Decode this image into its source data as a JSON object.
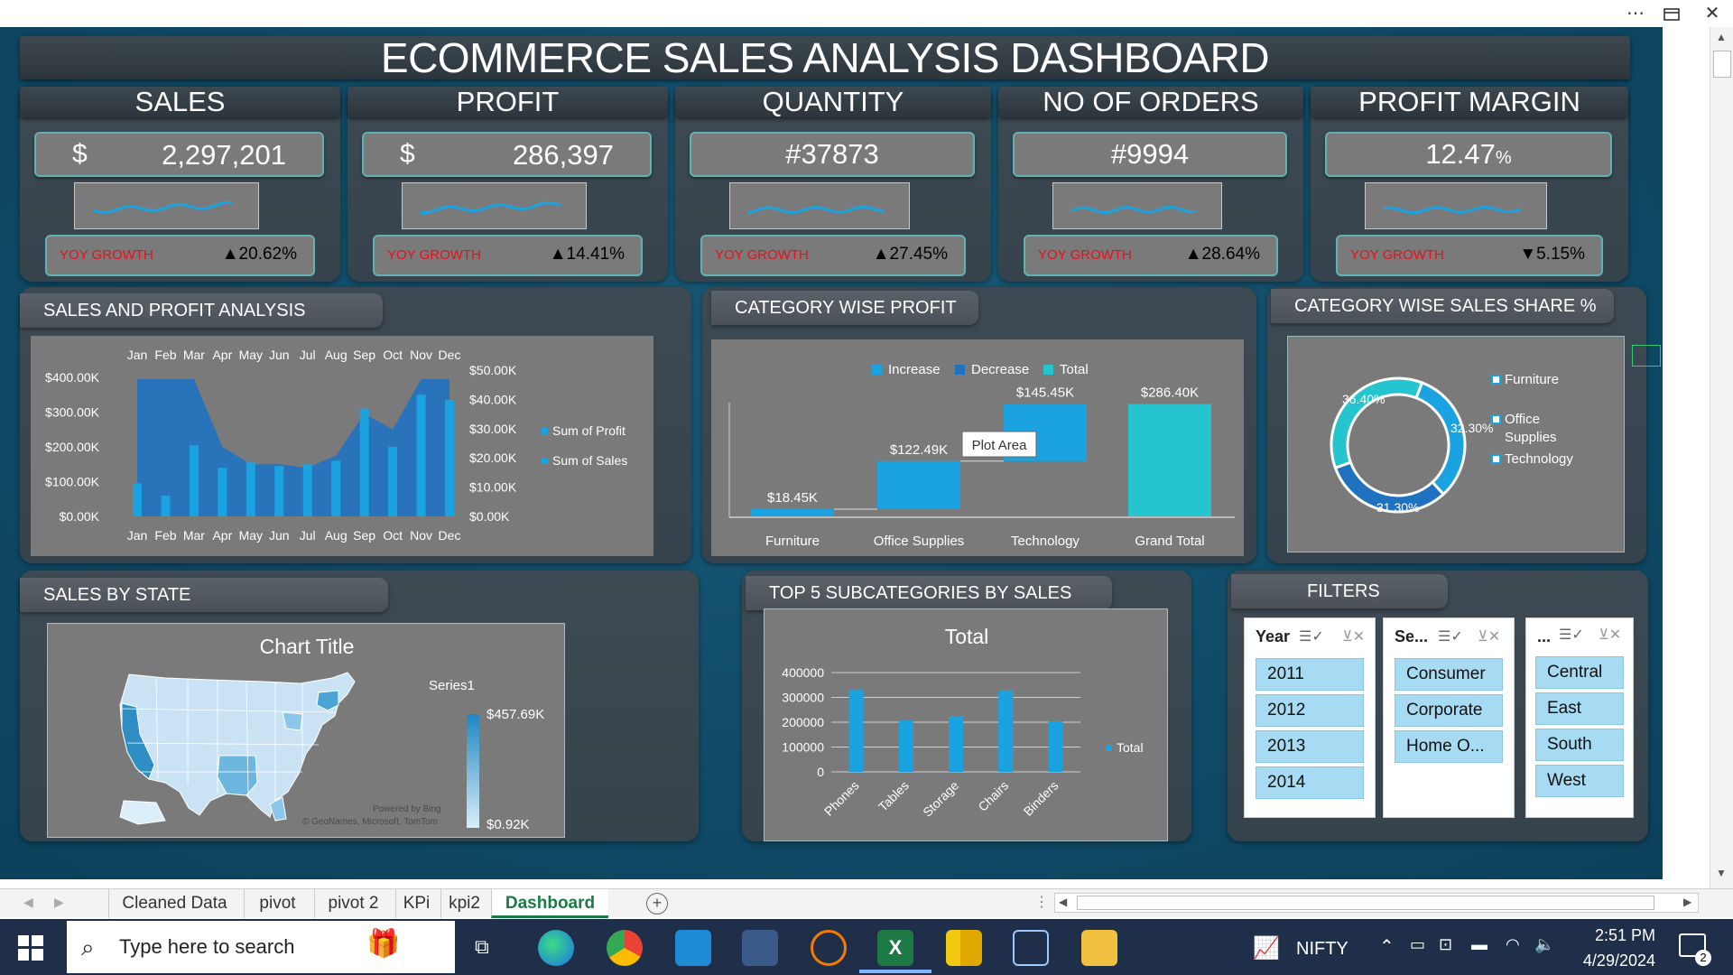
{
  "window": {
    "more_icon": "more-icon",
    "restore_icon": "restore-icon",
    "close_icon": "close-icon"
  },
  "dashboard": {
    "title": "ECOMMERCE SALES ANALYSIS DASHBOARD",
    "kpis": [
      {
        "label": "SALES",
        "currency": "$",
        "value": "2,297,201",
        "yoy_label": "YOY GROWTH",
        "yoy_value": "▲20.62%"
      },
      {
        "label": "PROFIT",
        "currency": "$",
        "value": "286,397",
        "yoy_label": "YOY GROWTH",
        "yoy_value": "▲14.41%"
      },
      {
        "label": "QUANTITY",
        "currency": "",
        "value": "#37873",
        "yoy_label": "YOY GROWTH",
        "yoy_value": "▲27.45%"
      },
      {
        "label": "NO OF ORDERS",
        "currency": "",
        "value": "#9994",
        "yoy_label": "YOY GROWTH",
        "yoy_value": "▲28.64%"
      },
      {
        "label": "PROFIT MARGIN",
        "currency": "",
        "value": "12.47",
        "value_unit": "%",
        "yoy_label": "YOY GROWTH",
        "yoy_value": "▼5.15%"
      }
    ],
    "sales_profit": {
      "title": "SALES AND PROFIT ANALYSIS",
      "legend": [
        "Sum of Profit",
        "Sum of Sales"
      ]
    },
    "category_profit": {
      "title": "CATEGORY WISE PROFIT",
      "legend": [
        "Increase",
        "Decrease",
        "Total"
      ],
      "tooltip": "Plot Area"
    },
    "category_share": {
      "title": "CATEGORY WISE SALES SHARE %",
      "legend": [
        "Furniture",
        "Office Supplies",
        "Technology"
      ]
    },
    "sales_by_state": {
      "title": "SALES BY STATE",
      "chart_title": "Chart Title",
      "legend_title": "Series1",
      "max_label": "$457.69K",
      "min_label": "$0.92K",
      "credit1": "Powered by Bing",
      "credit2": "© GeoNames, Microsoft, TomTom"
    },
    "top5": {
      "title": "TOP 5 SUBCATEGORIES BY SALES"
    },
    "filters": {
      "title": "FILTERS",
      "year": {
        "header": "Year",
        "items": [
          "2011",
          "2012",
          "2013",
          "2014"
        ]
      },
      "segment": {
        "header": "Se...",
        "items": [
          "Consumer",
          "Corporate",
          "Home O..."
        ]
      },
      "region": {
        "header": "...",
        "items": [
          "Central",
          "East",
          "South",
          "West"
        ]
      }
    }
  },
  "sheets": {
    "tabs": [
      "Cleaned Data",
      "pivot",
      "pivot 2",
      "KPi",
      "kpi2",
      "Dashboard"
    ],
    "active": "Dashboard"
  },
  "taskbar": {
    "search_placeholder": "Type here to search",
    "ticker": "NIFTY",
    "time": "2:51 PM",
    "date": "4/29/2024",
    "notifications": "2"
  },
  "colors": {
    "accent": "#1aa3e0",
    "teal": "#25c4cf",
    "dark_blue": "#1f72c0",
    "red": "#e8101a"
  },
  "chart_data": [
    {
      "type": "line",
      "title": "",
      "categories": [
        "Jan",
        "Feb",
        "Mar",
        "Apr",
        "May",
        "Jun",
        "Jul",
        "Aug",
        "Sep",
        "Oct",
        "Nov",
        "Dec"
      ],
      "series": [
        {
          "name": "Sum of Profit",
          "chart": "area",
          "axis": "left",
          "values": [
            395000,
            390000,
            395000,
            395000,
            395000,
            395000,
            395000,
            395000,
            395000,
            395000,
            395000,
            395000
          ]
        },
        {
          "name": "Sum of Sales",
          "chart": "bar",
          "axis": "left",
          "values": [
            95000,
            60000,
            205000,
            140000,
            155000,
            145000,
            150000,
            160000,
            310000,
            200000,
            350000,
            335000
          ]
        }
      ],
      "ylim_left": [
        0,
        400000
      ],
      "left_ticks": [
        "$0.00K",
        "$100.00K",
        "$200.00K",
        "$300.00K",
        "$400.00K"
      ],
      "right_ticks": [
        "$0.00K",
        "$10.00K",
        "$20.00K",
        "$30.00K",
        "$40.00K",
        "$50.00K"
      ],
      "area_shape": [
        395000,
        395000,
        395000,
        200000,
        150000,
        150000,
        140000,
        175000,
        295000,
        250000,
        395000,
        395000
      ]
    },
    {
      "type": "bar",
      "subtype": "waterfall",
      "categories": [
        "Furniture",
        "Office Supplies",
        "Technology",
        "Grand Total"
      ],
      "values": [
        18450,
        122490,
        145450,
        286400
      ],
      "labels": [
        "$18.45K",
        "$122.49K",
        "$145.45K",
        "$286.40K"
      ]
    },
    {
      "type": "pie",
      "subtype": "doughnut",
      "categories": [
        "Furniture",
        "Office Supplies",
        "Technology"
      ],
      "values": [
        31.3,
        32.3,
        36.4
      ],
      "labels": [
        "31.30%",
        "32.30%",
        "36.40%"
      ]
    },
    {
      "type": "bar",
      "title": "Total",
      "categories": [
        "Phones",
        "Tables",
        "Storage",
        "Chairs",
        "Binders"
      ],
      "values": [
        330000,
        207000,
        224000,
        328000,
        204000
      ],
      "ylim": [
        0,
        400000
      ],
      "yticks": [
        "0",
        "100000",
        "200000",
        "300000",
        "400000"
      ],
      "series_name": "Total"
    }
  ]
}
